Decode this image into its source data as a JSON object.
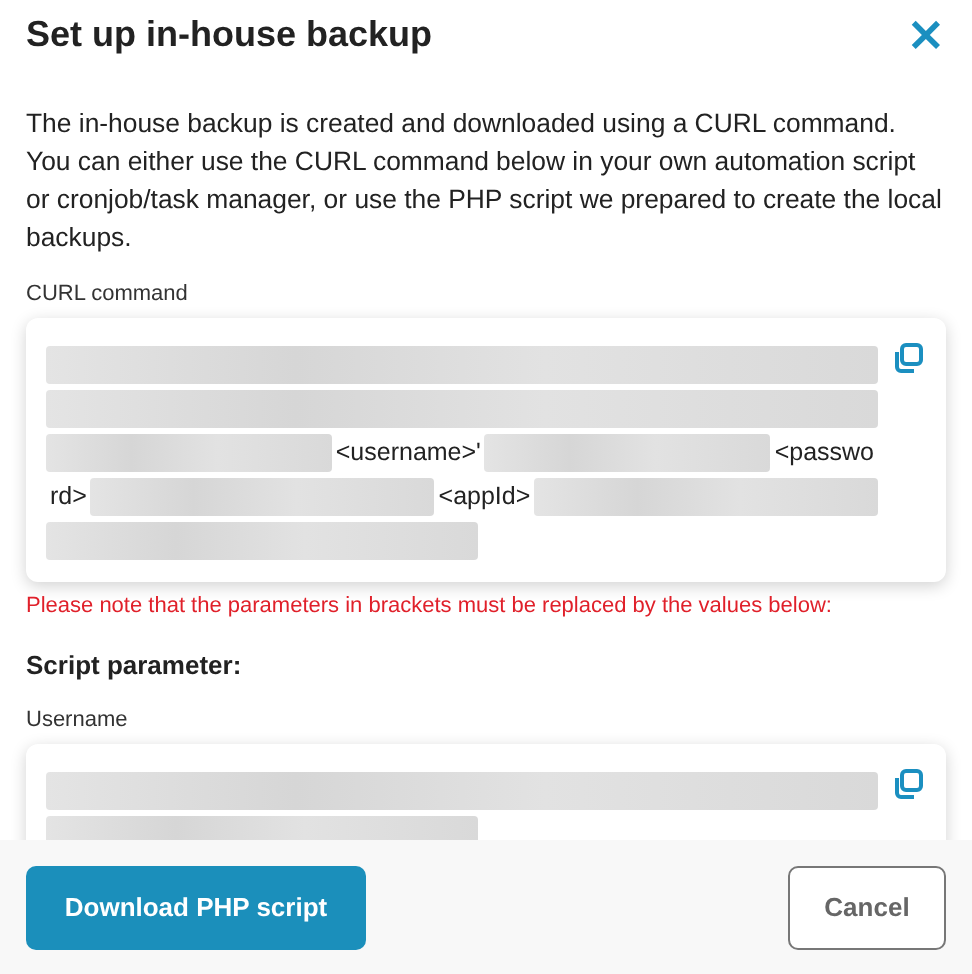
{
  "dialog": {
    "title": "Set up in-house backup",
    "close": "×"
  },
  "intro": "The in-house backup is created and downloaded using a CURL command. You can either use the CURL command below in your own automation script or cronjob/task manager, or use the PHP script we prepared to create the local backups.",
  "curl": {
    "label": "CURL command",
    "lines": [
      [
        {
          "kind": "redacted"
        }
      ],
      [
        {
          "kind": "redacted"
        }
      ],
      [
        {
          "kind": "redacted"
        },
        {
          "kind": "text",
          "text": "<username>'"
        },
        {
          "kind": "redacted"
        },
        {
          "kind": "text",
          "text": "<passwo"
        }
      ],
      [
        {
          "kind": "text",
          "text": "rd>"
        },
        {
          "kind": "redacted"
        },
        {
          "kind": "text",
          "text": "<appId>"
        },
        {
          "kind": "redacted"
        }
      ],
      [
        {
          "kind": "redacted_short"
        }
      ]
    ]
  },
  "note": "Please note that the parameters in brackets must be replaced by the values below:",
  "parameters": {
    "heading": "Script parameter:",
    "fields": [
      {
        "label": "Username",
        "lines": [
          [
            {
              "kind": "redacted"
            }
          ],
          [
            {
              "kind": "redacted_short"
            }
          ]
        ]
      }
    ]
  },
  "buttons": [
    {
      "label": "Download PHP script",
      "kind": "primary"
    },
    {
      "label": "Cancel",
      "kind": "secondary"
    }
  ]
}
